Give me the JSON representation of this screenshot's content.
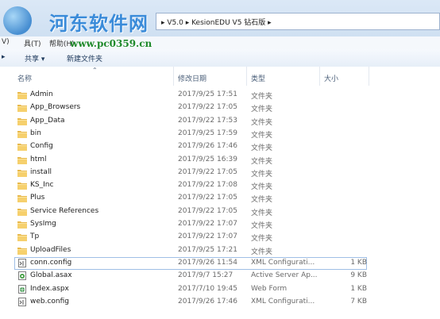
{
  "watermark": {
    "site_name": "河东软件网",
    "url": "www.pc0359.cn"
  },
  "address": {
    "path": "▸ V5.0 ▸ KesionEDU V5 钻石版 ▸"
  },
  "menu": {
    "view": "V)",
    "tools": "具(T)",
    "help": "帮助(H)"
  },
  "toolbar": {
    "share": "共享 ▾",
    "new_folder": "新建文件夹"
  },
  "columns": {
    "name": "名称",
    "date": "修改日期",
    "type": "类型",
    "size": "大小"
  },
  "files": [
    {
      "name": "Admin",
      "date": "2017/9/25 17:51",
      "type": "文件夹",
      "size": "",
      "icon": "folder-icon"
    },
    {
      "name": "App_Browsers",
      "date": "2017/9/22 17:05",
      "type": "文件夹",
      "size": "",
      "icon": "folder-icon"
    },
    {
      "name": "App_Data",
      "date": "2017/9/22 17:53",
      "type": "文件夹",
      "size": "",
      "icon": "folder-icon"
    },
    {
      "name": "bin",
      "date": "2017/9/25 17:59",
      "type": "文件夹",
      "size": "",
      "icon": "folder-icon"
    },
    {
      "name": "Config",
      "date": "2017/9/26 17:46",
      "type": "文件夹",
      "size": "",
      "icon": "folder-icon"
    },
    {
      "name": "html",
      "date": "2017/9/25 16:39",
      "type": "文件夹",
      "size": "",
      "icon": "folder-icon"
    },
    {
      "name": "install",
      "date": "2017/9/22 17:05",
      "type": "文件夹",
      "size": "",
      "icon": "folder-icon"
    },
    {
      "name": "KS_Inc",
      "date": "2017/9/22 17:08",
      "type": "文件夹",
      "size": "",
      "icon": "folder-icon"
    },
    {
      "name": "Plus",
      "date": "2017/9/22 17:05",
      "type": "文件夹",
      "size": "",
      "icon": "folder-icon"
    },
    {
      "name": "Service References",
      "date": "2017/9/22 17:05",
      "type": "文件夹",
      "size": "",
      "icon": "folder-icon"
    },
    {
      "name": "SysImg",
      "date": "2017/9/22 17:07",
      "type": "文件夹",
      "size": "",
      "icon": "folder-icon"
    },
    {
      "name": "Tp",
      "date": "2017/9/22 17:07",
      "type": "文件夹",
      "size": "",
      "icon": "folder-icon"
    },
    {
      "name": "UploadFiles",
      "date": "2017/9/25 17:21",
      "type": "文件夹",
      "size": "",
      "icon": "folder-icon"
    },
    {
      "name": "conn.config",
      "date": "2017/9/26 11:54",
      "type": "XML Configurati...",
      "size": "1 KB",
      "icon": "config-file-icon",
      "selected": true
    },
    {
      "name": "Global.asax",
      "date": "2017/9/7 15:27",
      "type": "Active Server Ap...",
      "size": "9 KB",
      "icon": "asax-file-icon"
    },
    {
      "name": "Index.aspx",
      "date": "2017/7/10 19:45",
      "type": "Web Form",
      "size": "1 KB",
      "icon": "aspx-file-icon"
    },
    {
      "name": "web.config",
      "date": "2017/9/26 17:46",
      "type": "XML Configurati...",
      "size": "7 KB",
      "icon": "config-file-icon"
    }
  ]
}
